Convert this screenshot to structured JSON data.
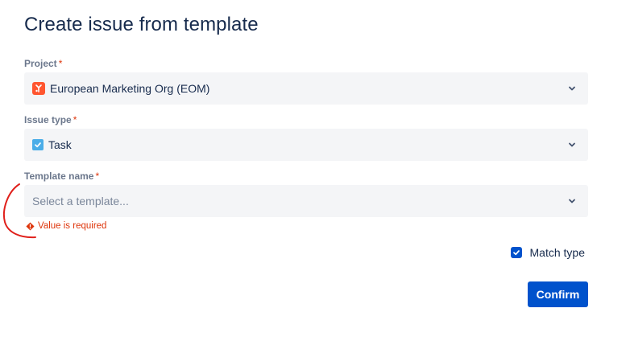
{
  "dialog": {
    "title": "Create issue from template"
  },
  "project": {
    "label": "Project",
    "required_mark": "*",
    "value": "European Marketing Org (EOM)",
    "icon": "project-avatar-icon"
  },
  "issue_type": {
    "label": "Issue type",
    "required_mark": "*",
    "value": "Task",
    "icon": "task-checkbox-icon"
  },
  "template": {
    "label": "Template name",
    "required_mark": "*",
    "placeholder": "Select a template...",
    "error": "Value is required",
    "error_icon": "error-icon"
  },
  "options": {
    "match_type_label": "Match type",
    "match_type_checked": true
  },
  "actions": {
    "confirm_label": "Confirm"
  },
  "colors": {
    "primary": "#0052cc",
    "error": "#de350b",
    "field_bg": "#f4f5f7",
    "text": "#172b4d",
    "label": "#6b778c",
    "annotation": "#e0201b"
  }
}
